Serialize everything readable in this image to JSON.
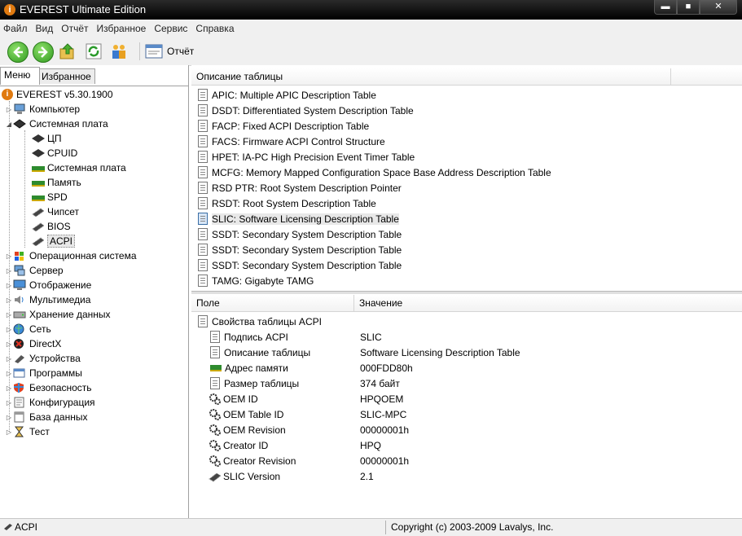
{
  "window": {
    "title": "EVEREST Ultimate Edition",
    "min_label": "▬",
    "max_label": "■",
    "close_label": "✕"
  },
  "menubar": [
    "Файл",
    "Вид",
    "Отчёт",
    "Избранное",
    "Сервис",
    "Справка"
  ],
  "toolbar": {
    "report_label": "Отчёт"
  },
  "tabs": {
    "menu": "Меню",
    "favorites": "Избранное"
  },
  "tree": {
    "root": "EVEREST v5.30.1900",
    "items": [
      {
        "label": "Компьютер",
        "icon": "computer-icon"
      },
      {
        "label": "Системная плата",
        "icon": "motherboard-icon",
        "children": [
          {
            "label": "ЦП",
            "icon": "cpu-icon"
          },
          {
            "label": "CPUID",
            "icon": "cpu-icon"
          },
          {
            "label": "Системная плата",
            "icon": "motherboard-icon"
          },
          {
            "label": "Память",
            "icon": "memory-icon"
          },
          {
            "label": "SPD",
            "icon": "memory-icon"
          },
          {
            "label": "Чипсет",
            "icon": "chip-icon"
          },
          {
            "label": "BIOS",
            "icon": "chip-icon"
          },
          {
            "label": "ACPI",
            "icon": "chip-icon"
          }
        ]
      },
      {
        "label": "Операционная система",
        "icon": "os-icon"
      },
      {
        "label": "Сервер",
        "icon": "server-icon"
      },
      {
        "label": "Отображение",
        "icon": "display-icon"
      },
      {
        "label": "Мультимедиа",
        "icon": "multimedia-icon"
      },
      {
        "label": "Хранение данных",
        "icon": "storage-icon"
      },
      {
        "label": "Сеть",
        "icon": "network-icon"
      },
      {
        "label": "DirectX",
        "icon": "directx-icon"
      },
      {
        "label": "Устройства",
        "icon": "devices-icon"
      },
      {
        "label": "Программы",
        "icon": "programs-icon"
      },
      {
        "label": "Безопасность",
        "icon": "security-icon"
      },
      {
        "label": "Конфигурация",
        "icon": "config-icon"
      },
      {
        "label": "База данных",
        "icon": "database-icon"
      },
      {
        "label": "Тест",
        "icon": "test-icon"
      }
    ]
  },
  "tables": {
    "header": "Описание таблицы",
    "rows": [
      "APIC: Multiple APIC Description Table",
      "DSDT: Differentiated System Description Table",
      "FACP: Fixed ACPI Description Table",
      "FACS: Firmware ACPI Control Structure",
      "HPET: IA-PC High Precision Event Timer Table",
      "MCFG: Memory Mapped Configuration Space Base Address Description Table",
      "RSD PTR: Root System Description Pointer",
      "RSDT: Root System Description Table",
      "SLIC: Software Licensing Description Table",
      "SSDT: Secondary System Description Table",
      "SSDT: Secondary System Description Table",
      "SSDT: Secondary System Description Table",
      "TAMG: Gigabyte TAMG"
    ]
  },
  "details": {
    "col_field": "Поле",
    "col_value": "Значение",
    "group": "Свойства таблицы ACPI",
    "rows": [
      {
        "field": "Подпись ACPI",
        "value": "SLIC",
        "icon": "document-icon"
      },
      {
        "field": "Описание таблицы",
        "value": "Software Licensing Description Table",
        "icon": "document-icon"
      },
      {
        "field": "Адрес памяти",
        "value": "000FDD80h",
        "icon": "memory-icon"
      },
      {
        "field": "Размер таблицы",
        "value": "374 байт",
        "icon": "document-icon"
      },
      {
        "field": "OEM ID",
        "value": "HPQOEM",
        "icon": "gears-icon"
      },
      {
        "field": "OEM Table ID",
        "value": "SLIC-MPC",
        "icon": "gears-icon"
      },
      {
        "field": "OEM Revision",
        "value": "00000001h",
        "icon": "gears-icon"
      },
      {
        "field": "Creator ID",
        "value": "HPQ",
        "icon": "gears-icon"
      },
      {
        "field": "Creator Revision",
        "value": "00000001h",
        "icon": "gears-icon"
      },
      {
        "field": "SLIC Version",
        "value": "2.1",
        "icon": "chip-icon"
      }
    ]
  },
  "status": {
    "left": "ACPI",
    "right": "Copyright (c) 2003-2009 Lavalys, Inc."
  },
  "colors": {
    "titlebar": "#111111",
    "window_bg": "#f0f0f0",
    "selection": "#e8e8e8"
  }
}
